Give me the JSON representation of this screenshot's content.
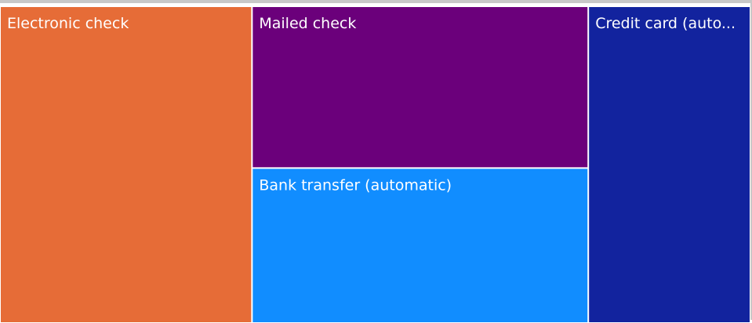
{
  "chart_data": {
    "type": "treemap",
    "labels": [
      "Electronic check",
      "Mailed check",
      "Bank transfer (automatic)",
      "Credit card (automatic)"
    ],
    "display_labels": [
      "Electronic check",
      "Mailed check",
      "Bank transfer (automatic)",
      "Credit card (auto..."
    ],
    "values": [
      2365,
      1612,
      1544,
      1522
    ],
    "colors": [
      "#E66C37",
      "#6B007B",
      "#118DFF",
      "#12239E"
    ]
  }
}
